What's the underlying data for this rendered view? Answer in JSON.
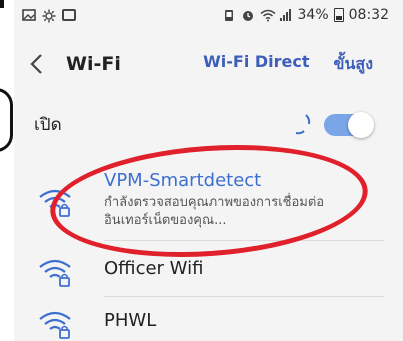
{
  "status_bar": {
    "battery": "34%",
    "time": "08:32",
    "icons": [
      "gallery-icon",
      "settings-icon",
      "screen-icon",
      "vibrate-icon",
      "alarm-icon",
      "wifi-icon",
      "signal-icon",
      "battery-icon"
    ]
  },
  "app_bar": {
    "back_icon": "back-chevron-icon",
    "title": "Wi-Fi",
    "wifi_direct_label": "Wi-Fi Direct",
    "advanced_label": "ขั้นสูง"
  },
  "master_switch": {
    "label": "เปิด",
    "state": "on",
    "scanning": true
  },
  "networks": [
    {
      "name": "VPM-Smartdetect",
      "status_line1": "กำลังตรวจสอบคุณภาพของการเชื่อมต่อ",
      "status_line2": "อินเทอร์เน็ตของคุณ...",
      "secured": true,
      "highlighted": true
    },
    {
      "name": "Officer Wifi",
      "secured": true
    },
    {
      "name": "PHWL",
      "secured": true
    }
  ],
  "colors": {
    "accent": "#3d6fd1",
    "toggle": "#7aa6e8",
    "annotation": "#e0202a"
  }
}
